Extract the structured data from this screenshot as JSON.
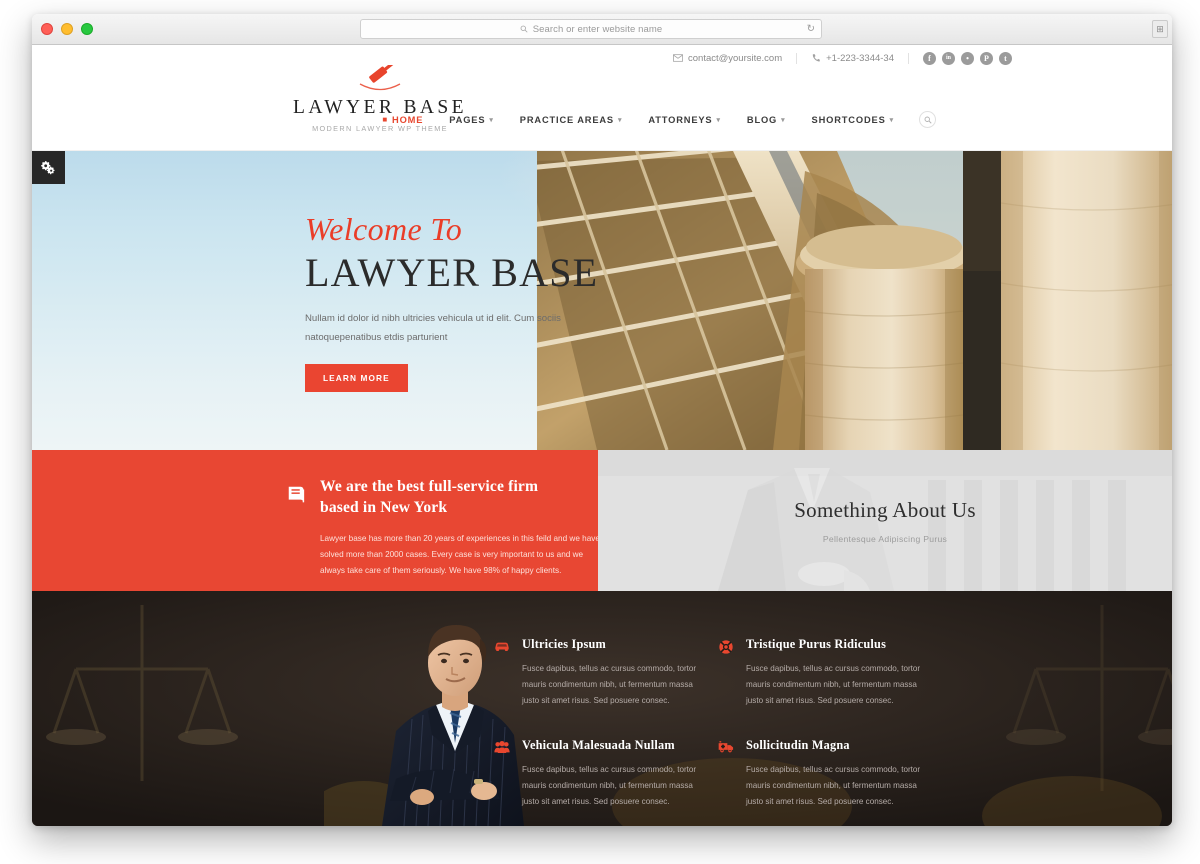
{
  "browser": {
    "address_placeholder": "Search or enter website name",
    "search_icon": "search-icon",
    "reload_icon": "reload-icon",
    "traffic_lights": [
      "close",
      "minimize",
      "zoom"
    ]
  },
  "topbar": {
    "email": "contact@yoursite.com",
    "email_icon": "envelope-icon",
    "phone": "+1-223-3344-34",
    "phone_icon": "phone-icon",
    "socials": [
      {
        "name": "facebook-icon",
        "glyph": "f"
      },
      {
        "name": "linkedin-icon",
        "glyph": "in"
      },
      {
        "name": "flickr-icon",
        "glyph": "•"
      },
      {
        "name": "pinterest-icon",
        "glyph": "P"
      },
      {
        "name": "twitter-icon",
        "glyph": "t"
      }
    ]
  },
  "brand": {
    "logo_icon": "gavel-icon",
    "name": "LAWYER BASE",
    "tagline": "MODERN LAWYER WP THEME"
  },
  "nav": {
    "items": [
      {
        "label": "HOME",
        "active": true,
        "caret": false
      },
      {
        "label": "PAGES",
        "active": false,
        "caret": true
      },
      {
        "label": "PRACTICE AREAS",
        "active": false,
        "caret": true
      },
      {
        "label": "ATTORNEYS",
        "active": false,
        "caret": true
      },
      {
        "label": "BLOG",
        "active": false,
        "caret": true
      },
      {
        "label": "SHORTCODES",
        "active": false,
        "caret": true
      }
    ],
    "search_icon": "search-icon"
  },
  "settings_tab": {
    "icon": "gears-icon"
  },
  "hero": {
    "eyebrow": "Welcome To",
    "title": "LAWYER BASE",
    "subtitle": "Nullam id dolor id nibh ultricies vehicula ut id elit. Cum sociis natoquepenatibus  etdis parturient",
    "button": "LEARN MORE"
  },
  "band": {
    "red": {
      "icon": "book-icon",
      "heading_line1": "We are the best full-service firm",
      "heading_line2": "based in New York",
      "body": "Lawyer base has more than 20 years of experiences in this feild and we have solved more than 2000 cases. Every case is very important to us and we always take care of them seriously. We have 98% of happy clients."
    },
    "about": {
      "title": "Something About Us",
      "subtitle": "Pellentesque Adipiscing Purus"
    }
  },
  "features": [
    {
      "icon": "car-icon",
      "title": "Ultricies Ipsum",
      "body": "Fusce dapibus, tellus ac cursus commodo, tortor mauris condimentum nibh, ut fermentum massa justo sit amet risus. Sed posuere consec."
    },
    {
      "icon": "lifebuoy-icon",
      "title": "Tristique Purus Ridiculus",
      "body": "Fusce dapibus, tellus ac cursus commodo, tortor mauris condimentum nibh, ut fermentum massa justo sit amet risus. Sed posuere consec."
    },
    {
      "icon": "group-icon",
      "title": "Vehicula Malesuada Nullam",
      "body": "Fusce dapibus, tellus ac cursus commodo, tortor mauris condimentum nibh, ut fermentum massa justo sit amet risus. Sed posuere consec."
    },
    {
      "icon": "ambulance-icon",
      "title": "Sollicitudin Magna",
      "body": "Fusce dapibus, tellus ac cursus commodo, tortor mauris condimentum nibh, ut fermentum massa justo sit amet risus. Sed posuere consec."
    }
  ],
  "colors": {
    "accent_red": "#E84733",
    "hero_eyebrow_red": "#EA3D28",
    "dark_section": "#231C19",
    "text_dark": "#2B2B2B"
  }
}
